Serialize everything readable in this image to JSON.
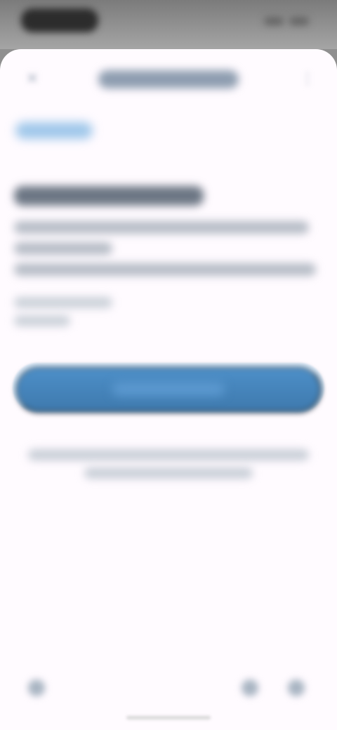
{
  "status_bar": {
    "time": "",
    "indicators": [
      "",
      ""
    ]
  },
  "header": {
    "title": "",
    "left_icon": "close-icon",
    "right_icon": "more-icon"
  },
  "navigation": {
    "back_text": ""
  },
  "content": {
    "headline": "",
    "paragraph_lines": [
      "",
      "",
      ""
    ],
    "helper_lines": [
      "",
      ""
    ]
  },
  "actions": {
    "primary_button_label": ""
  },
  "footer": {
    "note_lines": [
      "",
      ""
    ]
  },
  "bottom_bar": {
    "left_icon": "back-icon",
    "right_icons": [
      "tab-icon",
      "menu-icon"
    ]
  },
  "colors": {
    "accent": "#3e79ad",
    "background": "#fffbff",
    "muted_text": "#b6bcc6"
  }
}
